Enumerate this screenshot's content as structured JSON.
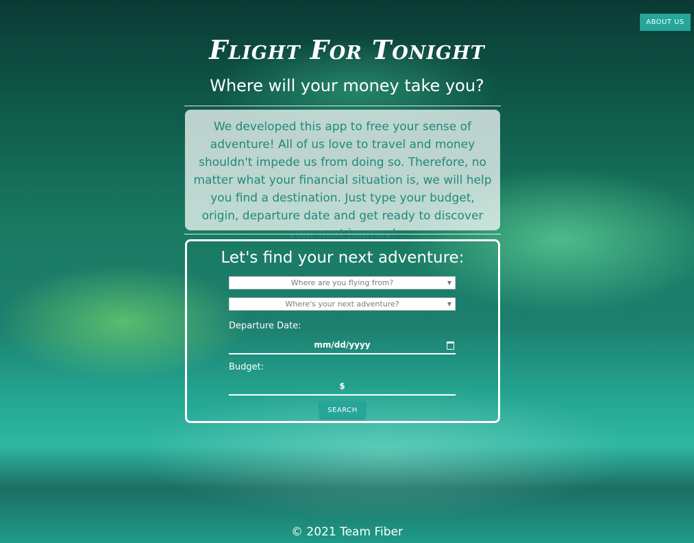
{
  "header": {
    "about_label": "ABOUT US",
    "title": "Flight For Tonight",
    "subtitle": "Where will your money take you?"
  },
  "intro": {
    "text": "We developed this app to free your sense of adventure! All of us love to travel and money shouldn't impede us from doing so. Therefore, no matter what your financial situation is, we will help you find a destination. Just type your budget, origin, departure date and get ready to discover your next journey!"
  },
  "search_form": {
    "heading": "Let's find your next adventure:",
    "origin_placeholder": "Where are you flying from?",
    "destination_placeholder": "Where's your next adventure?",
    "departure_label": "Departure Date:",
    "departure_value": "mm/dd/yyyy",
    "budget_label": "Budget:",
    "budget_value": "$",
    "search_label": "SEARCH"
  },
  "footer": {
    "text": "© 2021 Team Fiber"
  },
  "colors": {
    "accent": "#26a69a",
    "intro_text": "#1f8a7a",
    "card_border": "#ffffff"
  }
}
